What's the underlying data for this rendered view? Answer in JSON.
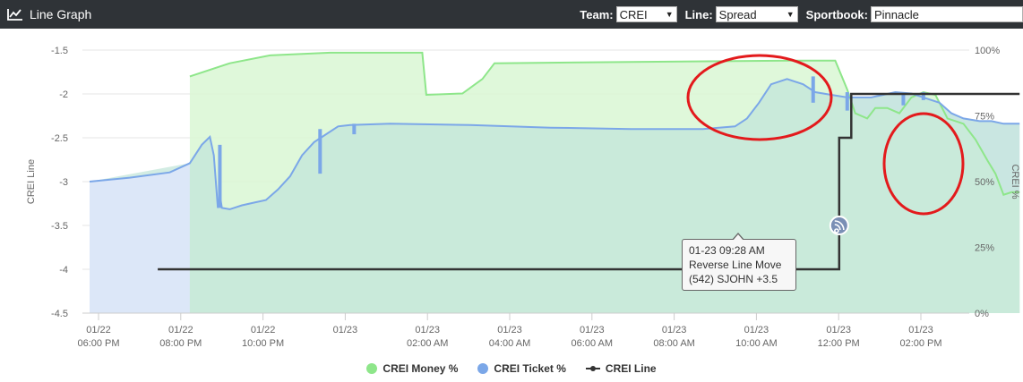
{
  "header": {
    "title": "Line Graph",
    "icon": "line-chart-icon",
    "team_label": "Team:",
    "team_value": "CREI",
    "line_label": "Line:",
    "line_value": "Spread",
    "book_label": "Sportbook:",
    "book_value": "Pinnacle"
  },
  "tooltip": {
    "line1": "01-23 09:28 AM",
    "line2": "Reverse Line Move",
    "line3": "(542) SJOHN +3.5"
  },
  "colors": {
    "money": "#8ee68a",
    "money_fill": "#d9f7d4",
    "ticket": "#7ba7e8",
    "ticket_fill": "#dce7f8",
    "line": "#333333",
    "annotation": "#e31a1c",
    "header_bg": "#2f3337"
  },
  "chart_data": {
    "type": "line",
    "title": "",
    "ylabel_left": "CREI Line",
    "ylabel_right": "CREI %",
    "ylim_left": [
      -4.5,
      -1.5
    ],
    "ylim_right": [
      0,
      100
    ],
    "yticks_left": [
      "-1.5",
      "-2",
      "-2.5",
      "-3",
      "-3.5",
      "-4",
      "-4.5"
    ],
    "yticks_right": [
      "100%",
      "75%",
      "50%",
      "25%",
      "0%"
    ],
    "xticks": [
      [
        "01/22",
        "06:00 PM"
      ],
      [
        "01/22",
        "08:00 PM"
      ],
      [
        "01/22",
        "10:00 PM"
      ],
      [
        "01/23",
        ""
      ],
      [
        "01/23",
        "02:00 AM"
      ],
      [
        "01/23",
        "04:00 AM"
      ],
      [
        "01/23",
        "06:00 AM"
      ],
      [
        "01/23",
        "08:00 AM"
      ],
      [
        "01/23",
        "10:00 AM"
      ],
      [
        "01/23",
        "12:00 PM"
      ],
      [
        "01/23",
        "02:00 PM"
      ]
    ],
    "x_hours_range": [
      17.5,
      39.0
    ],
    "grid": true,
    "legend_placement": "bottom-center",
    "series": [
      {
        "name": "CREI Money %",
        "axis": "right",
        "points": [
          [
            20.0,
            90
          ],
          [
            21.0,
            95
          ],
          [
            22.0,
            98
          ],
          [
            23.5,
            99
          ],
          [
            25.8,
            99
          ],
          [
            25.9,
            83
          ],
          [
            26.8,
            83.5
          ],
          [
            27.3,
            89
          ],
          [
            27.6,
            95
          ],
          [
            31.0,
            95.5
          ],
          [
            35.0,
            96
          ],
          [
            36.1,
            96
          ],
          [
            36.4,
            85
          ],
          [
            36.6,
            76
          ],
          [
            36.9,
            74
          ],
          [
            37.1,
            78
          ],
          [
            37.4,
            78
          ],
          [
            37.7,
            76
          ],
          [
            38.0,
            82
          ],
          [
            38.3,
            84
          ],
          [
            38.6,
            83
          ],
          [
            38.9,
            74
          ],
          [
            39.3,
            72
          ],
          [
            39.6,
            66
          ],
          [
            39.9,
            58
          ],
          [
            40.1,
            53
          ],
          [
            40.3,
            45
          ],
          [
            40.5,
            46
          ],
          [
            40.7,
            46
          ]
        ]
      },
      {
        "name": "CREI Ticket %",
        "axis": "right",
        "points": [
          [
            17.5,
            50
          ],
          [
            18.5,
            51.5
          ],
          [
            19.5,
            53.5
          ],
          [
            20.0,
            57
          ],
          [
            20.3,
            64
          ],
          [
            20.5,
            67
          ],
          [
            20.6,
            60
          ],
          [
            20.7,
            40
          ],
          [
            20.75,
            45
          ],
          [
            20.8,
            40
          ],
          [
            21.0,
            39.5
          ],
          [
            21.3,
            41
          ],
          [
            21.6,
            42
          ],
          [
            21.9,
            43
          ],
          [
            22.2,
            47
          ],
          [
            22.5,
            52
          ],
          [
            22.8,
            60
          ],
          [
            23.1,
            65
          ],
          [
            23.3,
            67
          ],
          [
            23.7,
            71
          ],
          [
            24.0,
            71.5
          ],
          [
            25.0,
            72
          ],
          [
            27.0,
            71.5
          ],
          [
            29.0,
            70.5
          ],
          [
            31.0,
            70
          ],
          [
            32.8,
            70
          ],
          [
            33.6,
            71
          ],
          [
            33.9,
            74
          ],
          [
            34.2,
            80
          ],
          [
            34.5,
            87
          ],
          [
            34.9,
            89
          ],
          [
            35.3,
            87
          ],
          [
            35.6,
            84
          ],
          [
            36.0,
            83
          ],
          [
            36.4,
            82
          ],
          [
            36.7,
            82
          ],
          [
            37.0,
            82
          ],
          [
            37.3,
            83
          ],
          [
            37.6,
            84
          ],
          [
            38.0,
            83.5
          ],
          [
            38.3,
            82
          ],
          [
            38.7,
            80
          ],
          [
            39.0,
            76
          ],
          [
            39.3,
            74
          ],
          [
            39.7,
            73
          ],
          [
            40.0,
            73
          ],
          [
            40.3,
            72
          ],
          [
            40.7,
            72
          ]
        ]
      },
      {
        "name": "CREI Line",
        "axis": "left",
        "points": [
          [
            19.2,
            -4.0
          ],
          [
            36.2,
            -4.0
          ],
          [
            36.2,
            -2.5
          ],
          [
            36.5,
            -2.5
          ],
          [
            36.5,
            -2.0
          ],
          [
            40.7,
            -2.0
          ]
        ]
      }
    ]
  }
}
